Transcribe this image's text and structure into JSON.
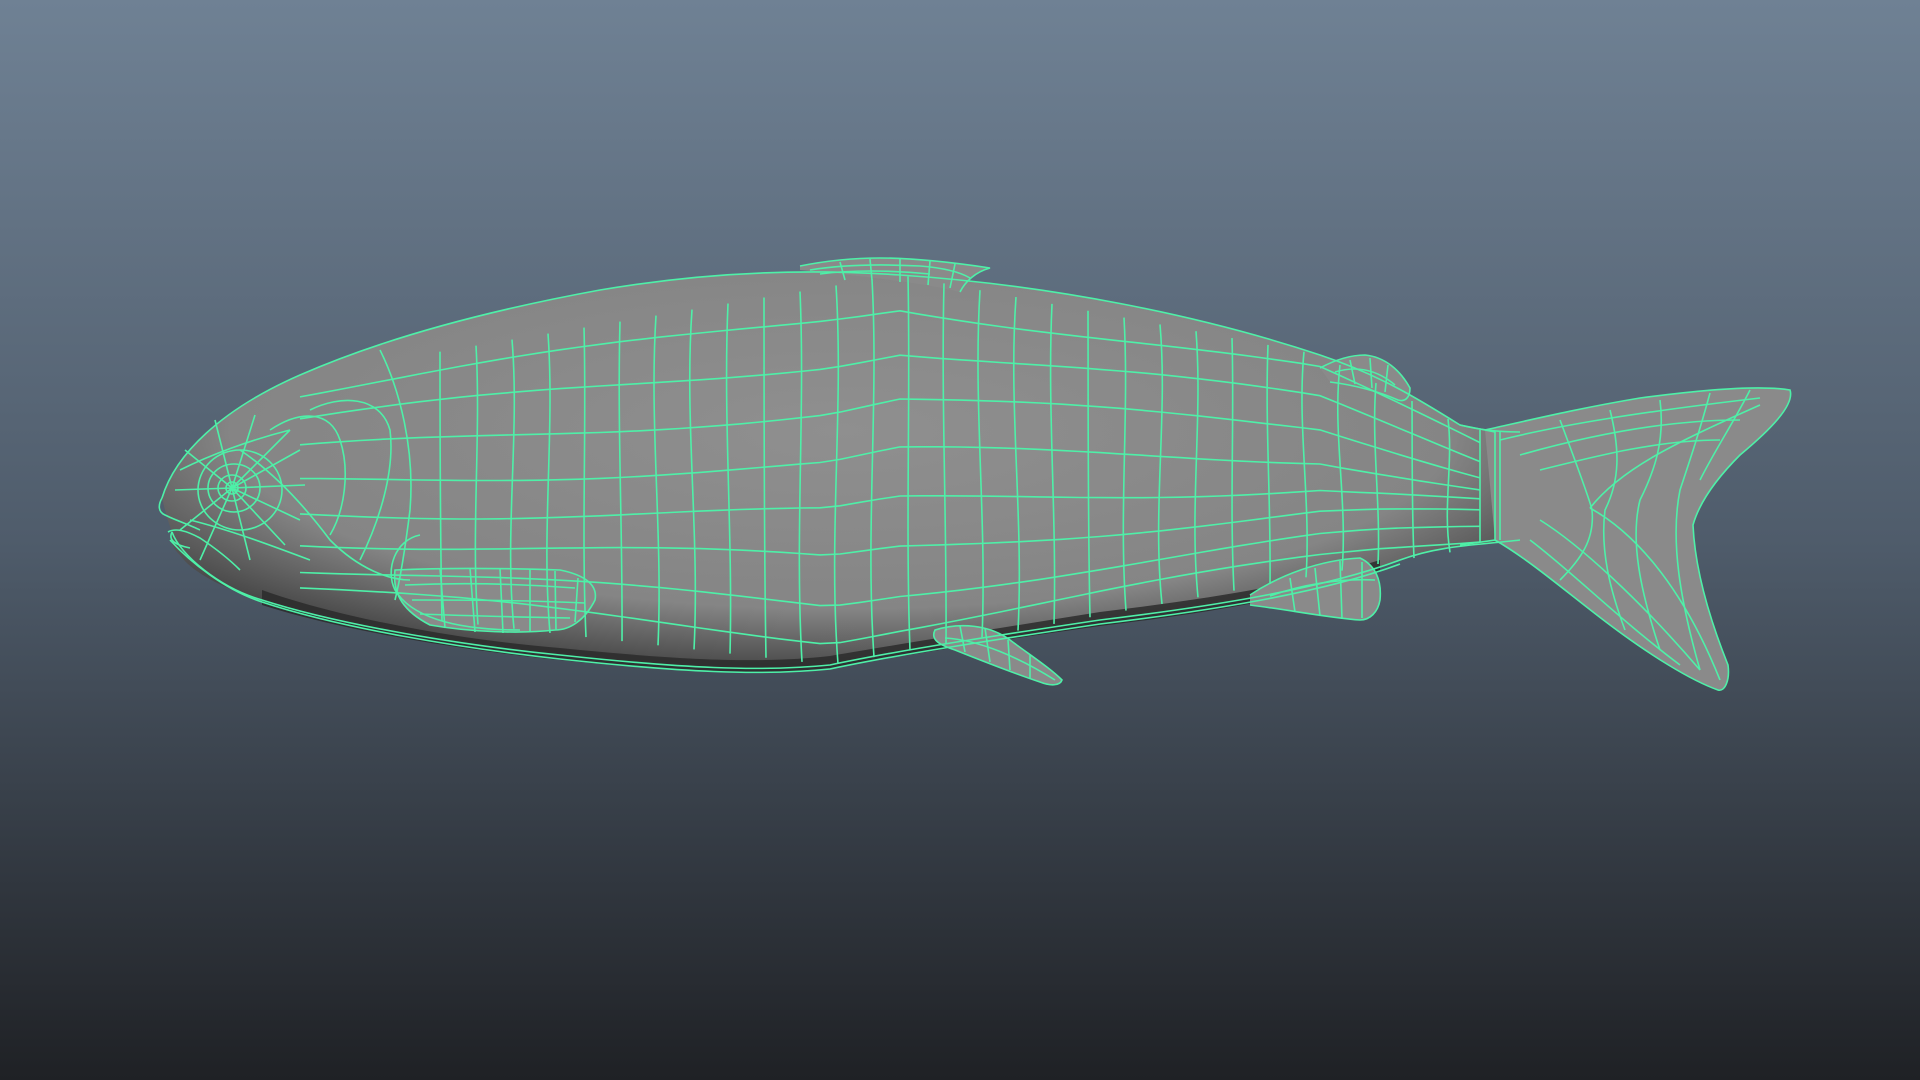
{
  "viewport": {
    "background_top": "#6f8194",
    "background_mid": "#4f5c6b",
    "background_bottom": "#1f2125"
  },
  "model": {
    "wire_color": "#4ef0a8",
    "surface_color": "#8c8c8c",
    "shadow_color": "#2a2a2a"
  }
}
